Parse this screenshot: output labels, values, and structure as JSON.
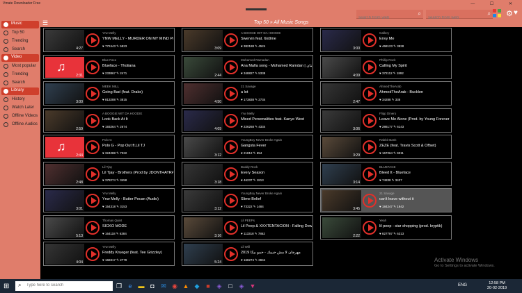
{
  "app": {
    "title": "Vmate Downloader Free",
    "search1_placeholder": "search from web",
    "search2_placeholder": "search from web",
    "window_controls": "—  ☐  ✕"
  },
  "header": {
    "page_title": "Top 50 » All Music Songs"
  },
  "sidebar": {
    "sections": [
      {
        "label": "Music",
        "items": [
          "Top 50",
          "Trending",
          "Search"
        ]
      },
      {
        "label": "Video",
        "items": [
          "Most popular",
          "Trending",
          "Search"
        ]
      },
      {
        "label": "Library",
        "items": [
          "History",
          "Watch Later",
          "Offline Videos",
          "Offline Audios"
        ]
      }
    ]
  },
  "columns": [
    [
      {
        "artist": "Yrw Melly",
        "title": "YNW MELLY - MURDER ON MY MIND Prod By:",
        "views": "772443",
        "likes": "5823",
        "duration": "4:27",
        "thumb": "photo"
      },
      {
        "artist": "Blue Face",
        "title": "Blueface - Thotiana",
        "views": "233867",
        "likes": "2471",
        "duration": "2:31",
        "thumb": "music"
      },
      {
        "artist": "MEEK MILL",
        "title": "Going Bad (feat. Drake)",
        "views": "813288",
        "likes": "3815",
        "duration": "3:00",
        "thumb": "photo"
      },
      {
        "artist": "A BOOGIE WIT DA HOODIE",
        "title": "Look Back At It",
        "views": "193264",
        "likes": "2674",
        "duration": "2:59",
        "thumb": "photo"
      },
      {
        "artist": "Polo G",
        "title": "Polo G - Pop Out  ft.Lil TJ",
        "views": "324288",
        "likes": "7322",
        "duration": "2:44",
        "thumb": "music"
      },
      {
        "artist": "Lil Tjay",
        "title": "Lil Tjay - Brothers (Prod by JDONTHATRACK 4",
        "views": "378274",
        "likes": "3458",
        "duration": "2:48",
        "thumb": "photo"
      },
      {
        "artist": "Yrw Melly",
        "title": "Ynw Melly - Butter Pecan (Audio)",
        "views": "154318",
        "likes": "3153",
        "duration": "3:01",
        "thumb": "photo"
      },
      {
        "artist": "Thomas Quint",
        "title": "SICKO MODE",
        "views": "164118",
        "likes": "6384",
        "duration": "5:13",
        "thumb": "photo"
      },
      {
        "artist": "Yrw Melly",
        "title": "Freddy Krueger (feat. Tee Grizzley)",
        "views": "168317",
        "likes": "2779",
        "duration": "4:04",
        "thumb": "photo"
      }
    ],
    [
      {
        "artist": "A BOOGIE WIT DA HOODIE",
        "title": "Swervin feat. 6ix9ine",
        "views": "382188",
        "likes": "4524",
        "duration": "3:09",
        "thumb": "photo"
      },
      {
        "artist": "Mohamed Ramadan",
        "title": "Ana Mafia song - Mohamed Ramdan | محمد رمضان",
        "views": "348827",
        "likes": "5338",
        "duration": "2:44",
        "thumb": "photo"
      },
      {
        "artist": "21 Savage",
        "title": "a lot",
        "views": "173838",
        "likes": "2734",
        "duration": "4:50",
        "thumb": "photo"
      },
      {
        "artist": "Yrw Melly",
        "title": "Mixed Personalities feat. Kanye West",
        "views": "226268",
        "likes": "4334",
        "duration": "4:09",
        "thumb": "photo"
      },
      {
        "artist": "YoungBoy Never Broke Again",
        "title": "Gangsta Fever",
        "views": "21812",
        "likes": "654",
        "duration": "3:12",
        "thumb": "photo"
      },
      {
        "artist": "Buddy Rock",
        "title": "Every Season",
        "views": "46237",
        "likes": "1813",
        "duration": "3:18",
        "thumb": "photo"
      },
      {
        "artist": "YoungBoy Never Broke Again",
        "title": "Slime Belief",
        "views": "73322",
        "likes": "1484",
        "duration": "3:12",
        "thumb": "photo"
      },
      {
        "artist": "Lil PEEPs",
        "title": "Lil Peep & XXXTENTACION - Falling Down",
        "views": "113318",
        "likes": "7862",
        "duration": "3:16",
        "thumb": "photo"
      },
      {
        "artist": "Lil Will",
        "title": "مهرجان لا مش حبيبك - حمو بيكا 2019",
        "views": "168274",
        "likes": "3844",
        "duration": "5:24",
        "thumb": "photo"
      }
    ],
    [
      {
        "artist": "Gallery",
        "title": "Envy Me",
        "views": "468123",
        "likes": "3828",
        "duration": "3:00",
        "thumb": "photo"
      },
      {
        "artist": "Phillip Rock",
        "title": "Calling My Spirit",
        "views": "372112",
        "likes": "1892",
        "duration": "4:09",
        "thumb": "photo"
      },
      {
        "artist": "AhmedTheArab",
        "title": "AhmedTheArab - Bucklen",
        "views": "34288",
        "likes": "338",
        "duration": "2:47",
        "thumb": "photo"
      },
      {
        "artist": "Flipp Dinero",
        "title": "Leave Me Alone (Prod. by Young Forever x Cast",
        "views": "286177",
        "likes": "6143",
        "duration": "3:06",
        "thumb": "photo"
      },
      {
        "artist": "Rabbit Bank",
        "title": "ZEZE (feat. Travis Scott & Offset)",
        "views": "167264",
        "likes": "9311",
        "duration": "3:29",
        "thumb": "photo"
      },
      {
        "artist": "BLUEFACE",
        "title": "Bleed It - Blueface",
        "views": "74838",
        "likes": "3437",
        "duration": "3:14",
        "thumb": "photo"
      },
      {
        "artist": "21 Savage",
        "title": "can't leave without it",
        "views": "184247",
        "likes": "1942",
        "duration": "3:45",
        "thumb": "photo"
      },
      {
        "artist": "Yeah",
        "title": "lil peep - star shopping (prod. kryptik)",
        "views": "827787",
        "likes": "6313",
        "duration": "2:22",
        "thumb": "photo"
      }
    ]
  ],
  "watermark": {
    "title": "Activate Windows",
    "subtitle": "Go to Settings to activate Windows."
  },
  "taskbar": {
    "search_placeholder": "Type here to search",
    "tray": "ENG",
    "time": "12:58 PM",
    "date": "20-02-2019"
  }
}
